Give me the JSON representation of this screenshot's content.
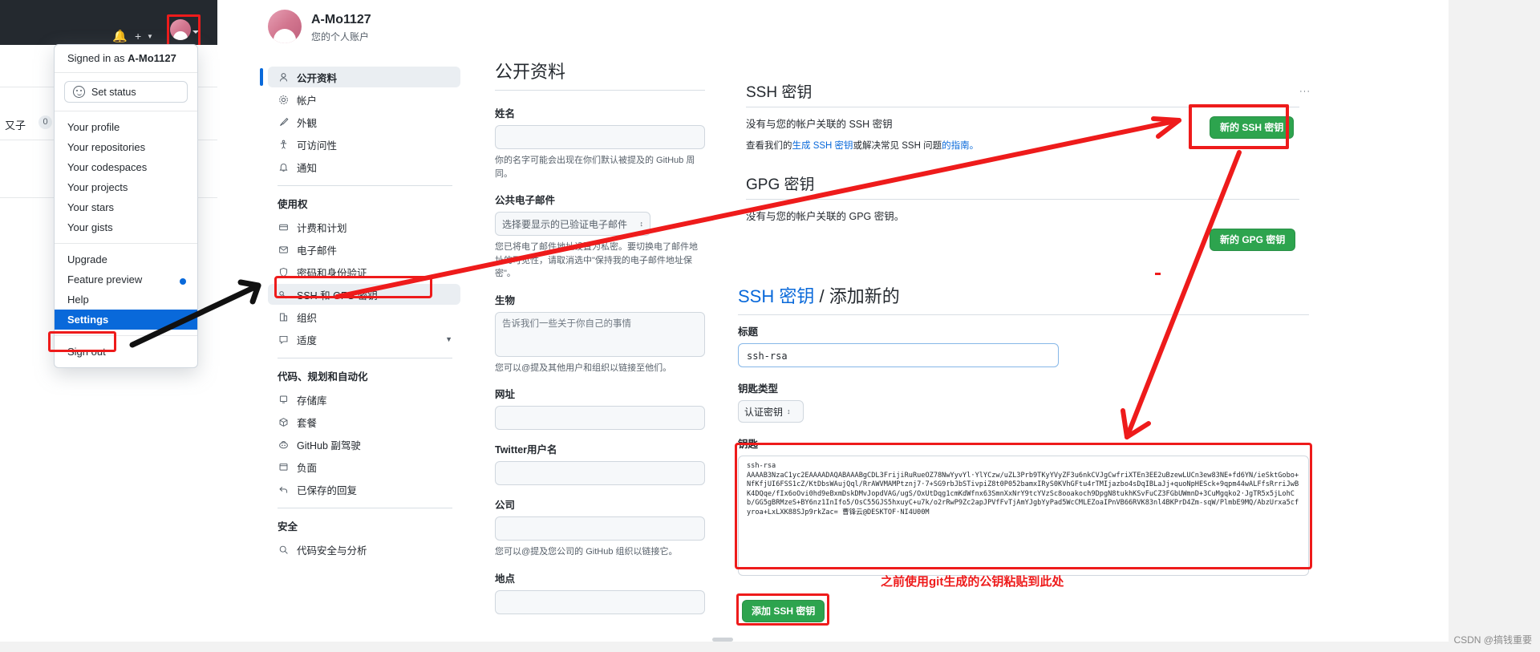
{
  "header": {
    "icons": [
      "bell-icon",
      "plus-icon",
      "chevron-down-icon",
      "avatar"
    ],
    "avatar_highlight_color": "#ee1b1b"
  },
  "left_strip": {
    "tab_label": "又子",
    "badge": "0"
  },
  "user_menu": {
    "signed_in_prefix": "Signed in as ",
    "signed_in_user": "A-Mo1127",
    "set_status": "Set status",
    "group1": [
      {
        "label": "Your profile"
      },
      {
        "label": "Your repositories"
      },
      {
        "label": "Your codespaces"
      },
      {
        "label": "Your projects"
      },
      {
        "label": "Your stars"
      },
      {
        "label": "Your gists"
      }
    ],
    "group2": [
      {
        "label": "Upgrade",
        "dot": false
      },
      {
        "label": "Feature preview",
        "dot": true
      },
      {
        "label": "Help",
        "dot": false
      },
      {
        "label": "Settings",
        "dot": false,
        "selected": true
      }
    ],
    "group3": [
      {
        "label": "Sign out"
      }
    ]
  },
  "profile_head": {
    "name": "A-Mo1127",
    "subtitle": "您的个人账户"
  },
  "settings_nav": {
    "items": [
      {
        "label": "公开资料",
        "icon": "person-icon",
        "active": true
      },
      {
        "label": "帐户",
        "icon": "gear-icon"
      },
      {
        "label": "外観",
        "icon": "paintbrush-icon"
      },
      {
        "label": "可访问性",
        "icon": "accessibility-icon"
      },
      {
        "label": "通知",
        "icon": "bell-icon"
      }
    ],
    "section_access": "使用权",
    "access_items": [
      {
        "label": "计费和计划",
        "icon": "creditcard-icon"
      },
      {
        "label": "电子邮件",
        "icon": "mail-icon"
      },
      {
        "label": "密码和身份验证",
        "icon": "shield-icon"
      },
      {
        "label": "SSH 和 GFG 密钥",
        "icon": "key-icon",
        "highlight": true
      },
      {
        "label": "组织",
        "icon": "organization-icon"
      },
      {
        "label": "适度",
        "icon": "comment-icon",
        "chevron": true
      }
    ],
    "section_code": "代码、规划和自动化",
    "code_items": [
      {
        "label": "存储库",
        "icon": "repo-icon"
      },
      {
        "label": "套餐",
        "icon": "package-icon"
      },
      {
        "label": "GitHub 副驾驶",
        "icon": "copilot-icon"
      },
      {
        "label": "负面",
        "icon": "browser-icon"
      },
      {
        "label": "已保存的回复",
        "icon": "reply-icon"
      }
    ],
    "section_security": "安全",
    "security_items": [
      {
        "label": "代码安全与分析",
        "icon": "codescan-icon"
      }
    ]
  },
  "public_profile": {
    "title": "公开资料",
    "name_label": "姓名",
    "name_value": "",
    "name_help": "你的名字可能会出现在你们默认被提及的 GitHub 周同。",
    "email_label": "公共电子邮件",
    "email_placeholder": "选择要显示的已验证电子邮件",
    "email_help": "您已将电了邮件地址设置为私密。要切换电了邮件地址的可见性，请取消选中\"保持我的电子邮件地址保密\"。",
    "bio_label": "生物",
    "bio_placeholder": "告诉我们一些关于你自己的事情",
    "bio_help": "您可以@提及其他用户和组织以链接至他们。",
    "url_label": "网址",
    "url_value": "",
    "twitter_label": "Twitter用户名",
    "twitter_value": "",
    "company_label": "公司",
    "company_value": "",
    "company_help": "您可以@提及您公司的 GitHub 组织以链接它。",
    "location_label": "地点",
    "location_value": ""
  },
  "ssh_section": {
    "heading": "SSH 密钥",
    "empty_text": "没有与您的帐户关联的 SSH 密钥",
    "note_prefix": "查看我们的",
    "note_link1": "生成 SSH 密钥",
    "note_mid": "或解决常见 SSH 问题",
    "note_link2": "的指南。",
    "new_button": "新的 SSH 密钥",
    "dots": "···"
  },
  "gpg_section": {
    "heading": "GPG 密钥",
    "empty_text": "没有与您的帐户关联的 GPG 密钥。",
    "new_button": "新的 GPG 密钥"
  },
  "add_key_form": {
    "title_blue": "SSH 密钥",
    "title_sep": " / ",
    "title_rest": "添加新的",
    "title_label": "标题",
    "title_value": "ssh-rsa",
    "keytype_label": "钥匙类型",
    "keytype_value": "认证密钥",
    "key_label": "钥匙",
    "key_value": "ssh-rsa\nAAAAB3NzaC1yc2EAAAADAQABAAABgCDL3FrijiRuRueOZ78NwYyvYl·YlYCzw/uZL3Prb9TKyYVyZF3u6nkCVJgCwfriXTEn3EE2uBzewLUCn3ew83NE+fd6YN/ieSktGobo+NfKfjUI6FSS1cZ/KtDbsWAujQql/RrAWVMAMPtznj7·7+SG9rbJbSTivpiZ8t0P052bamxIRyS0KVhGFtu4rTMIjazbo4sDqIBLaJj+quoNpHESck+9qpm44wALFfsRrriJwBK4DQqe/fIx6oOvi0hd9eBxmDskDMvJopdVAG/ugS/OxUtDqg1cmKdWfnx63SmnXxNrY9tcYVzSc8ooakoch9DpgN8tukhKSvFuCZ3FGbUWmnD+3CuMgqko2·JgTR5x5jLohCb/GG5gBRMzeS+BY6nz1InIfo5/OsC55GJS5hxuyC+u7k/o2rRwP9Zc2apJPVfFvTjAmYJgbYyPad5WcCMLEZoaIPnVB66RVK83nl4BKPrD4Zm-sqW/PlmbE9MQ/AbzUrxa5cfyroa+LxLXK88SJp9rkZac= 曹锋云@DESKTOF·NI4U00M",
    "annotation": "之前使用git生成的公钥粘贴到此处",
    "submit_button": "添加 SSH 密钥"
  },
  "watermark": "CSDN @搞钱重要",
  "colors": {
    "accent_blue": "#0969da",
    "green_button": "#2da44e",
    "annotation_red": "#ee1b1b",
    "header_dark": "#24292f"
  }
}
